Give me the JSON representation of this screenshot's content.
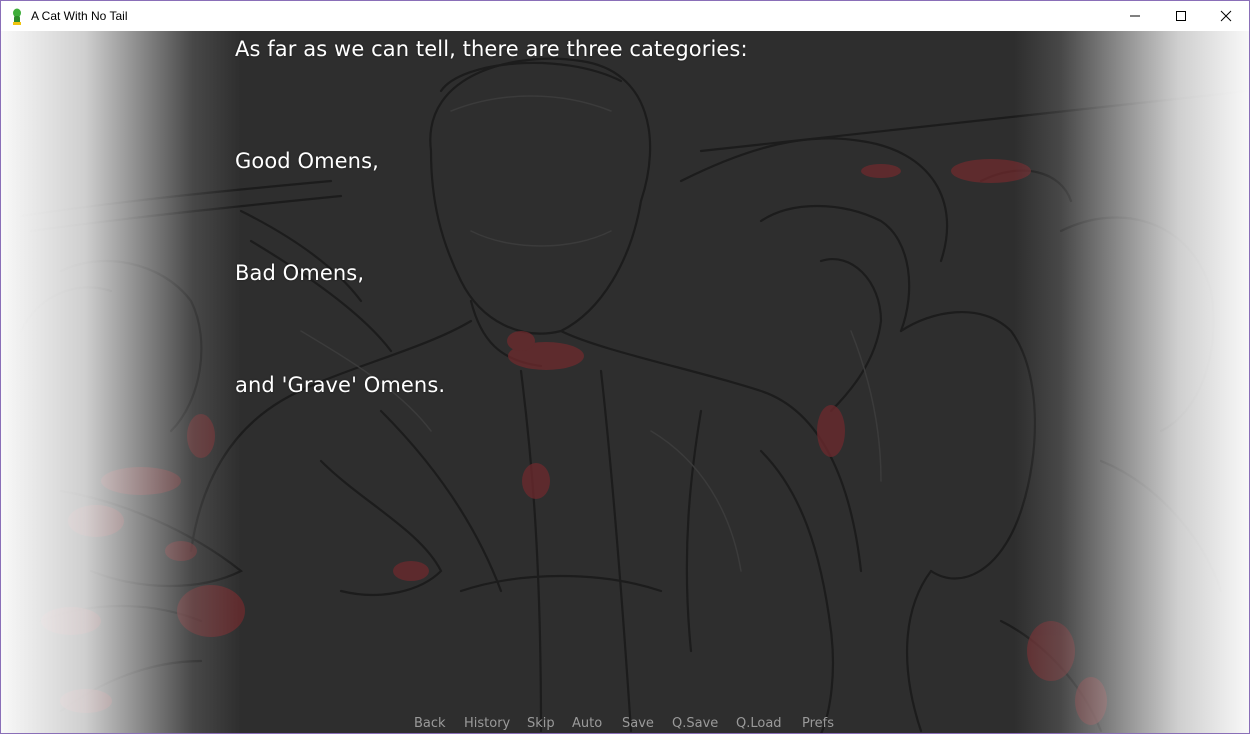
{
  "window": {
    "title": "A Cat With No Tail"
  },
  "dialogue": {
    "lines": [
      "As far as we can tell, there are three categories:",
      "Good Omens,",
      "Bad Omens,",
      "and 'Grave' Omens."
    ]
  },
  "quick_menu": {
    "items": [
      "Back",
      "History",
      "Skip",
      "Auto",
      "Save",
      "Q.Save",
      "Q.Load",
      "Prefs"
    ]
  },
  "colors": {
    "title_bar": "#ffffff",
    "window_border": "#8a6fb8",
    "game_background": "#2f2f2f",
    "dialogue_text": "#ffffff",
    "quick_menu_text": "#9a9a9a",
    "blood_accent": "#7a2a2e"
  },
  "icons": {
    "app": "green-figure-icon",
    "minimize": "minimize-icon",
    "maximize": "maximize-icon",
    "close": "close-icon"
  }
}
